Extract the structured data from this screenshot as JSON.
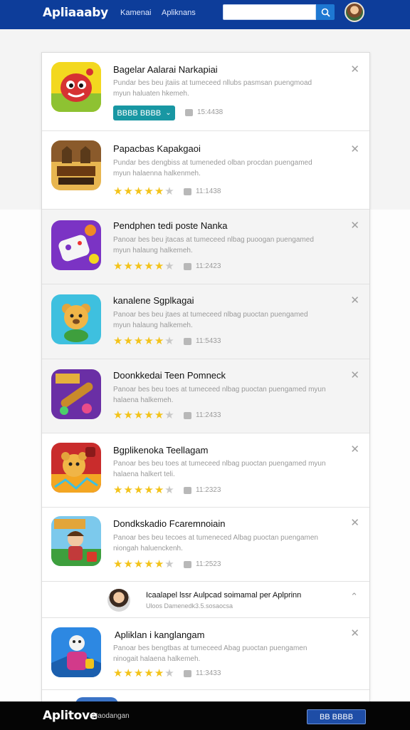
{
  "header": {
    "logo": "Apliaaaby",
    "nav": [
      "Kamenai",
      "Apliknans"
    ],
    "search_placeholder": "",
    "search_icon": "search-icon",
    "avatar_icon": "user-avatar"
  },
  "apps": [
    {
      "title": "Bagelar Aalarai Narkapiai",
      "desc": "Pundar bes beu jtaiis at tumeceed nllubs pasmsan puengmoad myun haluaten hkemeh.",
      "button": "BBBB BBBB",
      "meta": "15:4438",
      "icon": "red-monster-icon",
      "colors": [
        "#f3d81f",
        "#d63232"
      ]
    },
    {
      "title": "Papacbas Kapakgaoi",
      "desc": "Pundar bes dengbiss at tumeneded olban procdan puengamed myun halaenna halkenmeh.",
      "rating": 5,
      "meta": "11:1438",
      "icon": "castle-game-icon",
      "colors": [
        "#8a5a2b",
        "#e8b650"
      ]
    },
    {
      "title": "Pendphen tedi poste Nanka",
      "desc": "Panoar bes beu jtacas at tumeceed nlbag puoogan puengamed myun halaung halkemeh.",
      "rating": 4,
      "meta": "11:2423",
      "icon": "gamepad-icon",
      "colors": [
        "#7b33c4",
        "#f08a24"
      ]
    },
    {
      "title": "kanalene Sgplkagai",
      "desc": "Panoar bes beu jtaes at tumeceed nlbag puoctan puengamed myun halaung halkemeh.",
      "rating": 4,
      "meta": "11:5433",
      "icon": "teddy-bear-icon",
      "colors": [
        "#3ec0df",
        "#f0b547"
      ]
    },
    {
      "title": "Doonkkedai Teen Pomneck",
      "desc": "Panoar bes beu toes at tumeceed nlbag puoctan puengamed myun halaena halkemeh.",
      "rating": 4,
      "meta": "11:2433",
      "icon": "candy-cannon-icon",
      "colors": [
        "#6a2fa5",
        "#e4b03c"
      ]
    },
    {
      "title": "Bgplikenoka Teellagam",
      "desc": "Panoar bes beu toes at tumeceed nlbag puoctan puengamed myun halaena halkert teli.",
      "rating": 4,
      "meta": "11:2323",
      "icon": "bear-hero-icon",
      "colors": [
        "#c92c2c",
        "#f3a623"
      ]
    },
    {
      "title": "Dondkskadio Fcaremnoiain",
      "desc": "Panoar bes beu tecoes at tumeneced Albag puoctan puengamen niongah haluenckenh.",
      "rating": 4,
      "meta": "11:2523",
      "icon": "adventure-hero-icon",
      "colors": [
        "#3e9f3d",
        "#e2a53a"
      ]
    }
  ],
  "sponsored": {
    "title": "Icaalapel lssr Aulpcad soimamal per Aplprinn",
    "subtitle": "Uloos Damenedk3.5.sosaocsa",
    "avatar_icon": "user-avatar"
  },
  "last_app": {
    "title": "Apliklan i kanglangam",
    "desc": "Panoar bes bengtbas at tumeceed Abag puoctan puengamen ninogait halaena halkemeh.",
    "rating": 4,
    "meta": "11:3433",
    "icon": "snowman-character-icon",
    "colors": [
      "#2d88e2",
      "#d23a8a"
    ]
  },
  "footer": {
    "logo": "Aplitove",
    "subtitle": "Naodangan",
    "button": "BB BBBB"
  }
}
